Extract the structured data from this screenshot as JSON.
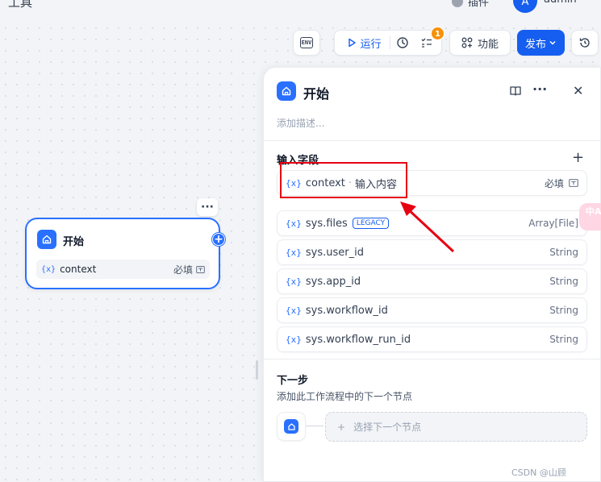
{
  "topbar": {
    "title": "工具",
    "plugin_label": "插件",
    "avatar_letter": "A",
    "user_name": "admin"
  },
  "toolbar": {
    "env_label": "ENV",
    "run_label": "运行",
    "badge_count": "1",
    "feature_label": "功能",
    "publish_label": "发布"
  },
  "canvas_node": {
    "menu_label": "···",
    "title": "开始",
    "variable": {
      "icon": "{x}",
      "name": "context",
      "required_label": "必填"
    },
    "add_label": "+"
  },
  "panel": {
    "title": "开始",
    "more_label": "···",
    "close_label": "✕",
    "description_placeholder": "添加描述...",
    "input_section_title": "输入字段",
    "add_field_label": "+",
    "highlighted_field": {
      "icon": "{x}",
      "name": "context",
      "label": "输入内容",
      "required_label": "必填"
    },
    "system_fields": [
      {
        "icon": "{x}",
        "name": "sys.files",
        "tag": "LEGACY",
        "type": "Array[File]"
      },
      {
        "icon": "{x}",
        "name": "sys.user_id",
        "type": "String"
      },
      {
        "icon": "{x}",
        "name": "sys.app_id",
        "type": "String"
      },
      {
        "icon": "{x}",
        "name": "sys.workflow_id",
        "type": "String"
      },
      {
        "icon": "{x}",
        "name": "sys.workflow_run_id",
        "type": "String"
      }
    ],
    "next_section_title": "下一步",
    "next_description": "添加此工作流程中的下一个节点",
    "next_plus": "+",
    "next_select_label": "选择下一个节点"
  },
  "side_chip_text": "中A",
  "watermark": "CSDN @山顾",
  "colors": {
    "accent": "#155eef",
    "highlight_annotation": "#e60012",
    "badge": "#f79009"
  }
}
